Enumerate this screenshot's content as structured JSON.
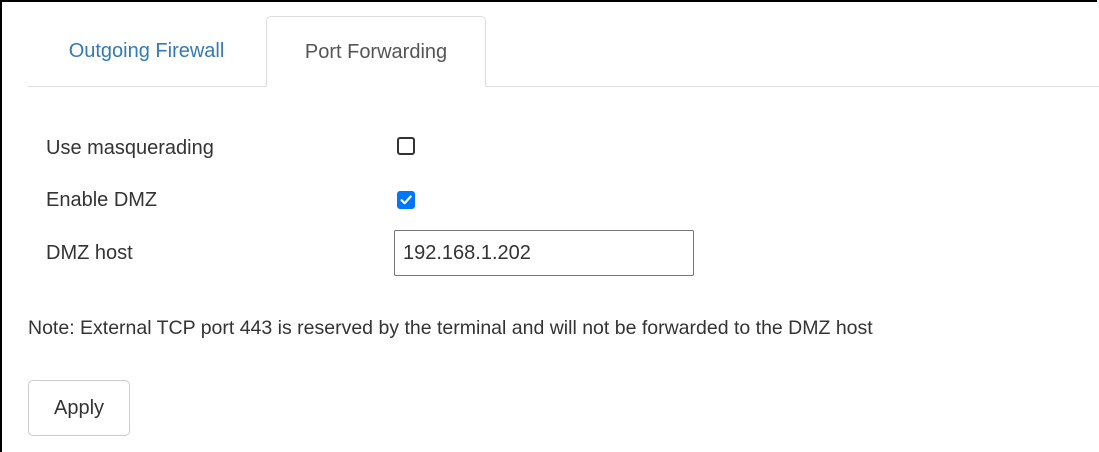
{
  "tabs": {
    "outgoing_firewall": "Outgoing Firewall",
    "port_forwarding": "Port Forwarding",
    "active": "Port Forwarding"
  },
  "form": {
    "masquerading": {
      "label": "Use masquerading",
      "checked": false
    },
    "dmz_enable": {
      "label": "Enable DMZ",
      "checked": true
    },
    "dmz_host": {
      "label": "DMZ host",
      "value": "192.168.1.202"
    }
  },
  "note": "Note: External TCP port 443 is reserved by the terminal and will not be forwarded to the DMZ host",
  "apply_label": "Apply",
  "colors": {
    "tab_link": "#337ab7",
    "checkbox_accent": "#0075ff",
    "text": "#333333",
    "border": "#dddddd"
  }
}
